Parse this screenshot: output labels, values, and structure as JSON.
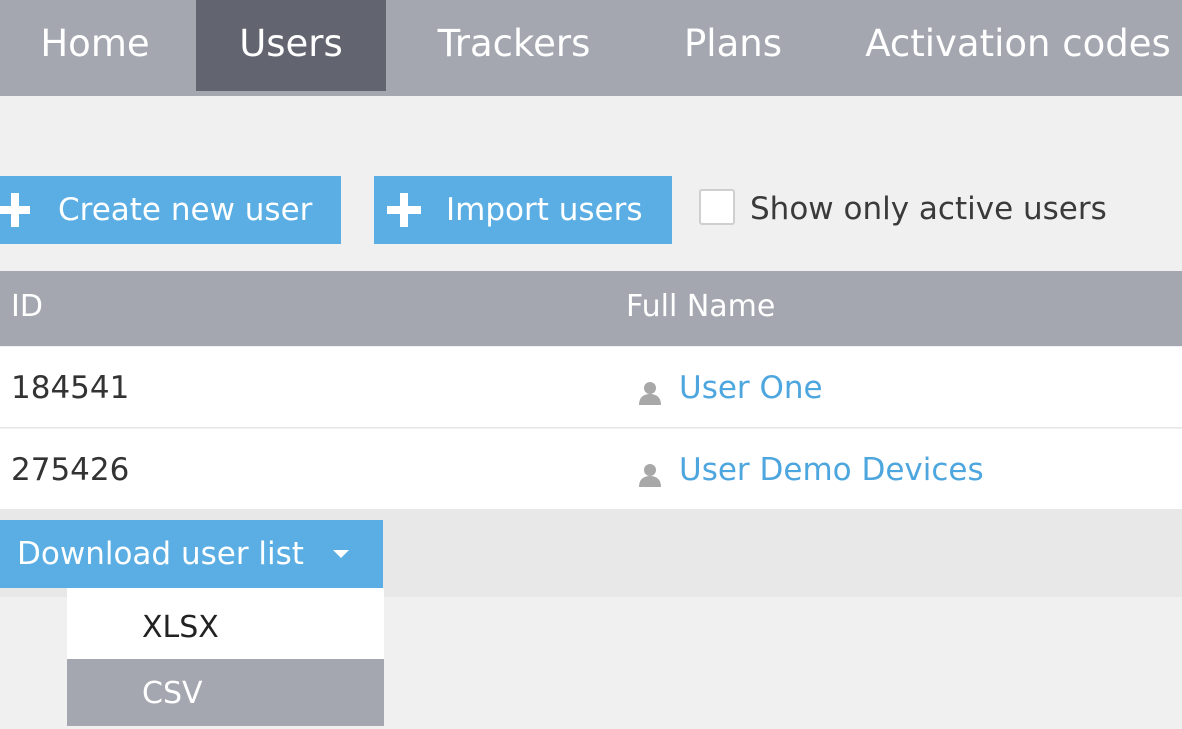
{
  "nav": {
    "items": [
      {
        "label": "Home",
        "active": false
      },
      {
        "label": "Users",
        "active": true
      },
      {
        "label": "Trackers",
        "active": false
      },
      {
        "label": "Plans",
        "active": false
      },
      {
        "label": "Activation codes",
        "active": false
      }
    ]
  },
  "toolbar": {
    "create_label": "Create new user",
    "import_label": "Import users",
    "active_filter_label": "Show only active users",
    "active_filter_checked": false
  },
  "table": {
    "columns": [
      "ID",
      "Full Name"
    ],
    "rows": [
      {
        "id": "184541",
        "name": "User One",
        "icon": "person-icon"
      },
      {
        "id": "275426",
        "name": "User Demo Devices",
        "icon": "person-icon"
      }
    ]
  },
  "download": {
    "label": "Download user list",
    "options": [
      "XLSX",
      "CSV"
    ],
    "highlighted": "CSV"
  },
  "colors": {
    "nav_bg": "#a4a7b0",
    "nav_active": "#62656f",
    "accent": "#5aaee3",
    "link": "#4ea6df",
    "page_bg": "#f0f0f0"
  }
}
